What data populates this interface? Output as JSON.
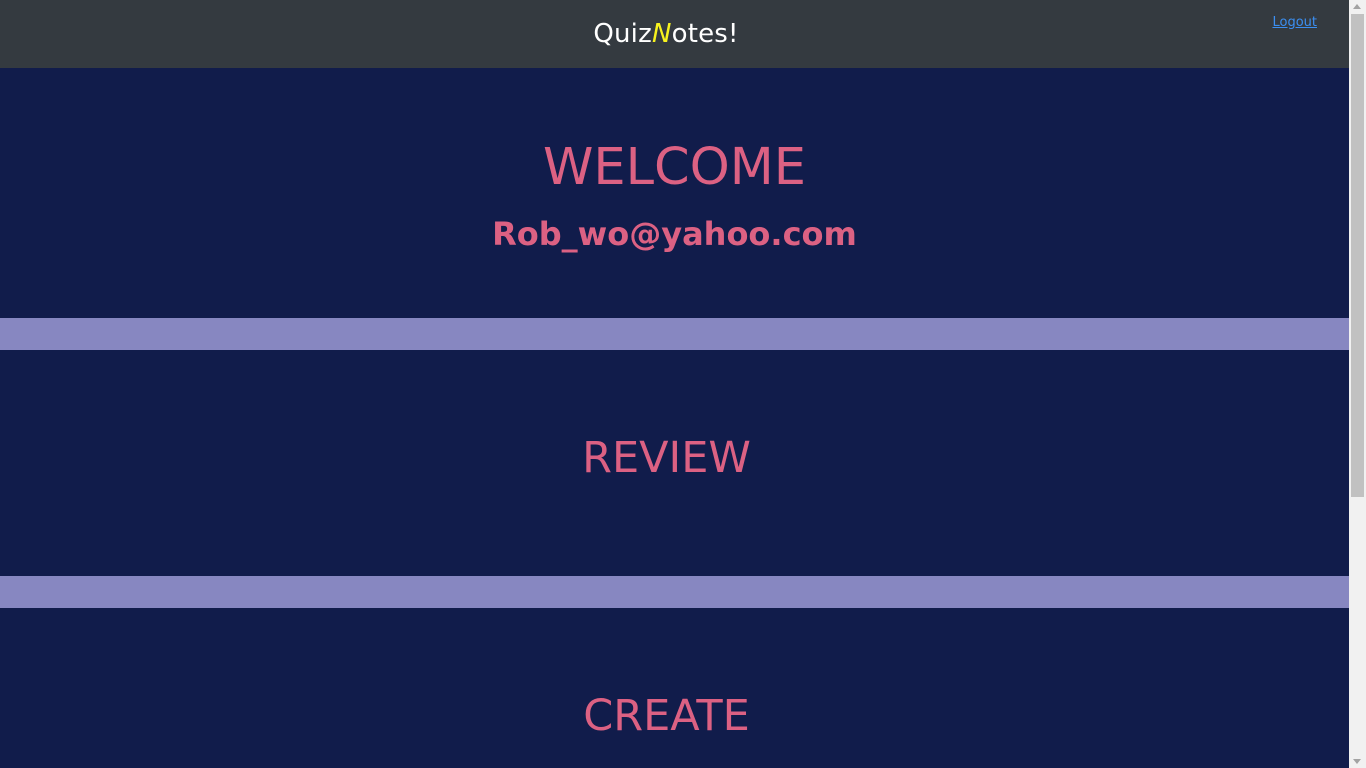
{
  "header": {
    "brand_prefix": "Quiz",
    "brand_accent": "N",
    "brand_suffix": "otes!",
    "logout_label": "Logout"
  },
  "welcome": {
    "title": "WELCOME",
    "email": "Rob_wo@yahoo.com"
  },
  "sections": {
    "review_label": "REVIEW",
    "create_label": "CREATE"
  },
  "colors": {
    "background": "#111c4b",
    "topbar": "#343a40",
    "accent_pink": "#dc6183",
    "divider": "#8787c1",
    "brand_accent": "#f7f21e",
    "link": "#3b8ff2"
  }
}
